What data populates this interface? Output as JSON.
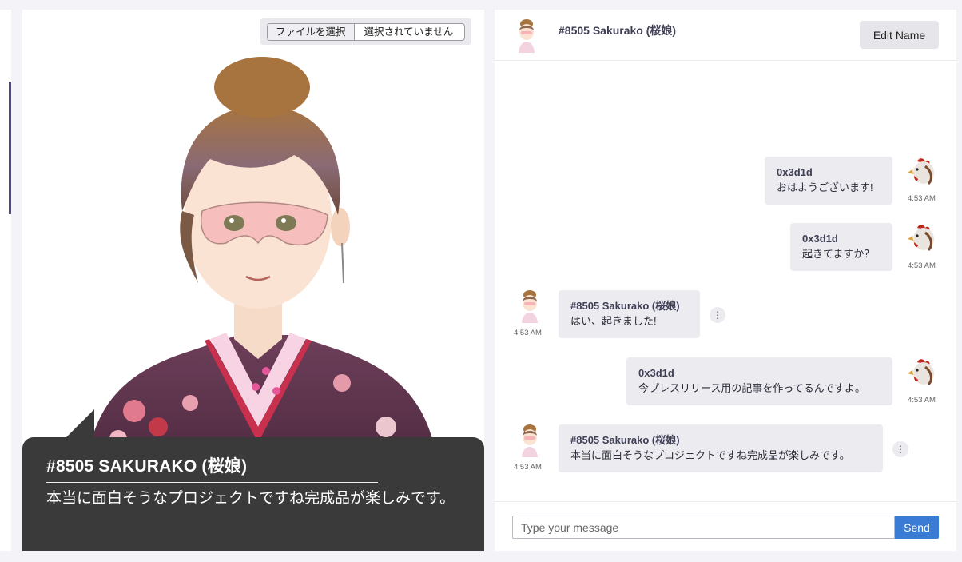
{
  "file_picker": {
    "button_label": "ファイルを選択",
    "status": "選択されていません"
  },
  "caption": {
    "name": "#8505 SAKURAKO (桜娘)",
    "text": "本当に面白そうなプロジェクトですね完成品が楽しみです。"
  },
  "chat": {
    "header": {
      "name": "#8505 Sakurako (桜娘)",
      "edit_button": "Edit Name"
    },
    "messages": [
      {
        "sender": "0x3d1d",
        "text": "おはようございます!",
        "time": "4:53 AM",
        "side": "right",
        "avatar": "rooster-icon"
      },
      {
        "sender": "0x3d1d",
        "text": "起きてますか？",
        "time": "4:53 AM",
        "side": "right",
        "avatar": "rooster-icon"
      },
      {
        "sender": "#8505 Sakurako (桜娘)",
        "text": "はい、起きました!",
        "time": "4:53 AM",
        "side": "left",
        "avatar": "sakurako-avatar"
      },
      {
        "sender": "0x3d1d",
        "text": "今プレスリリース用の記事を作ってるんですよ。",
        "time": "4:53 AM",
        "side": "right",
        "avatar": "rooster-icon"
      },
      {
        "sender": "#8505 Sakurako (桜娘)",
        "text": "本当に面白そうなプロジェクトですね完成品が楽しみです。",
        "time": "4:53 AM",
        "side": "left",
        "avatar": "sakurako-avatar"
      }
    ],
    "message_options_icon": "⋮",
    "composer": {
      "placeholder": "Type your message",
      "send_label": "Send"
    }
  },
  "colors": {
    "accent": "#3a7bd5",
    "caption_bg": "#3a3a3a",
    "bubble_bg": "#ebebf0",
    "sidebar_accent": "#4b4880"
  }
}
